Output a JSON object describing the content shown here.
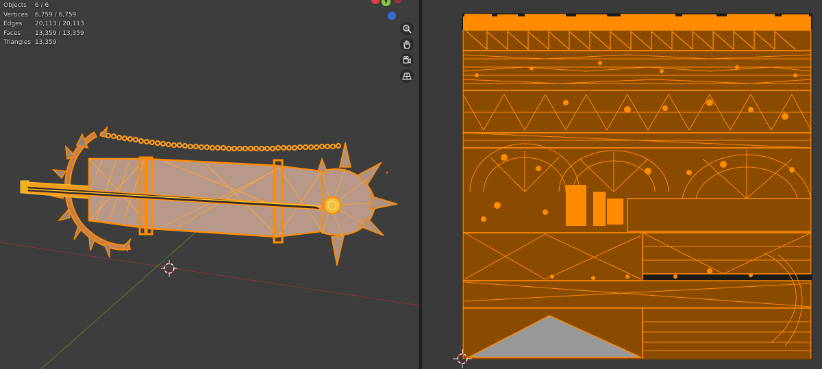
{
  "viewport": {
    "stats": [
      {
        "label": "Objects",
        "value": "6 / 6"
      },
      {
        "label": "Vertices",
        "value": "6,759 / 6,759"
      },
      {
        "label": "Edges",
        "value": "20,113 / 20,113"
      },
      {
        "label": "Faces",
        "value": "13,359 / 13,359"
      },
      {
        "label": "Triangles",
        "value": "13,359"
      }
    ],
    "gizmo": {
      "y_label": "Y"
    },
    "nav_buttons": [
      {
        "name": "zoom-icon"
      },
      {
        "name": "hand-pan-icon"
      },
      {
        "name": "camera-view-icon"
      },
      {
        "name": "grid-perspective-icon"
      }
    ]
  },
  "colors": {
    "selection_orange": "#ff8c00",
    "mesh_fill": "#b89888",
    "uv_fill": "#8a4a00",
    "uv_background": "#1a1a1a",
    "gizmo_x": "#e04040",
    "gizmo_y": "#8cc63f",
    "gizmo_z": "#3a6ad8"
  }
}
